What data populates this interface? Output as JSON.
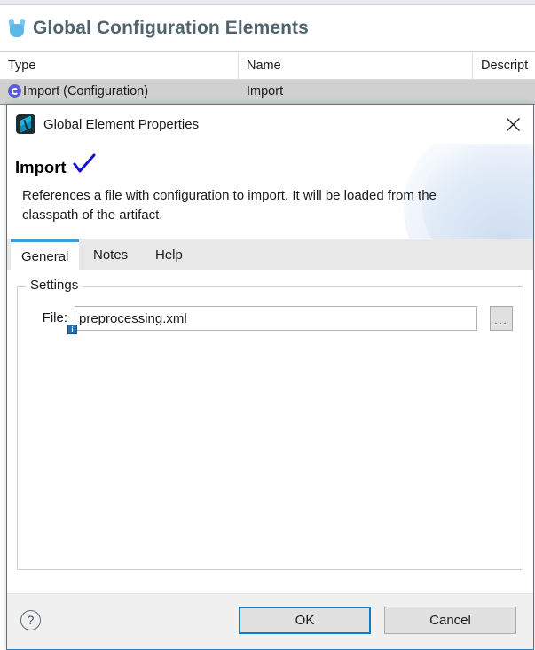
{
  "background": {
    "view_title": "Global Configuration Elements",
    "view_icon": "mule-icon",
    "table": {
      "columns": [
        "Type",
        "Name",
        "Descript"
      ],
      "rows": [
        {
          "icon": "global-config-icon",
          "type": "Import (Configuration)",
          "name": "Import",
          "description": ""
        }
      ]
    }
  },
  "dialog": {
    "app_icon": "anypoint-studio-icon",
    "title": "Global Element Properties",
    "close_icon": "close-icon",
    "heading": "Import",
    "heading_badge_icon": "blue-checkmark-icon",
    "description": "References a file with configuration to import. It will be loaded from the classpath of the artifact.",
    "tabs": [
      {
        "label": "General",
        "active": true
      },
      {
        "label": "Notes",
        "active": false
      },
      {
        "label": "Help",
        "active": false
      }
    ],
    "settings": {
      "group_title": "Settings",
      "file_label": "File:",
      "file_value": "preprocessing.xml",
      "file_placeholder": "",
      "info_badge": "i",
      "browse_label": "...",
      "browse_icon": "ellipsis-icon"
    },
    "footer": {
      "help_icon": "help-question-icon",
      "ok_label": "OK",
      "cancel_label": "Cancel"
    }
  },
  "colors": {
    "accent_blue": "#0f7ac7",
    "tab_active_border": "#3aa0d8",
    "dialog_border": "#2a7fc0",
    "row_selected": "#d0d0d0",
    "title_gray": "#50646f",
    "info_badge": "#2a6fa8"
  }
}
